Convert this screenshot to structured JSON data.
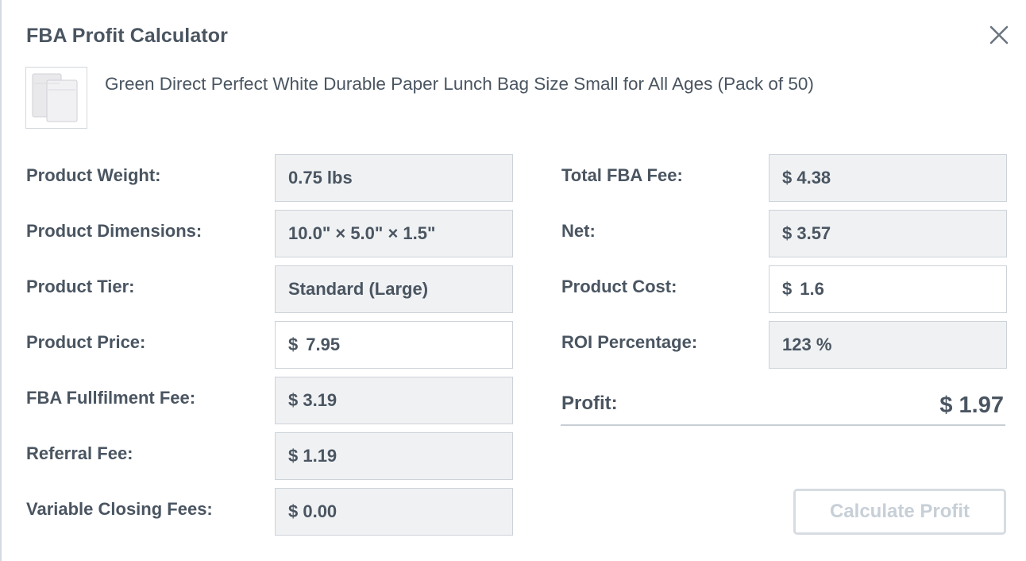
{
  "dialog": {
    "title": "FBA Profit Calculator"
  },
  "product": {
    "name": "Green Direct Perfect White Durable Paper Lunch Bag Size Small for All Ages (Pack of 50)"
  },
  "left_fields": [
    {
      "label": "Product Weight:",
      "value": "0.75 lbs"
    },
    {
      "label": "Product Dimensions:",
      "value": "10.0\" × 5.0\" × 1.5\""
    },
    {
      "label": "Product Tier:",
      "value": "Standard (Large)"
    },
    {
      "label": "Product Price:",
      "currency": "$",
      "value": "7.95"
    },
    {
      "label": "FBA Fullfilment Fee:",
      "value": "$ 3.19"
    },
    {
      "label": "Referral Fee:",
      "value": "$ 1.19"
    },
    {
      "label": "Variable Closing Fees:",
      "value": "$ 0.00"
    }
  ],
  "right_fields": [
    {
      "label": "Total FBA Fee:",
      "value": "$ 4.38"
    },
    {
      "label": "Net:",
      "value": "$ 3.57"
    },
    {
      "label": "Product Cost:",
      "currency": "$",
      "value": "1.6"
    },
    {
      "label": "ROI Percentage:",
      "value": "123 %"
    }
  ],
  "profit": {
    "label": "Profit:",
    "value": "$ 1.97"
  },
  "actions": {
    "calculate_label": "Calculate Profit"
  },
  "icons": {
    "close": "close-icon",
    "thumbnail": "paper-bag-thumbnail"
  },
  "colors": {
    "text": "#4a5561",
    "field_bg": "#eff1f3",
    "border": "#cdd3d9",
    "button_text_disabled": "#c7cfd7"
  }
}
